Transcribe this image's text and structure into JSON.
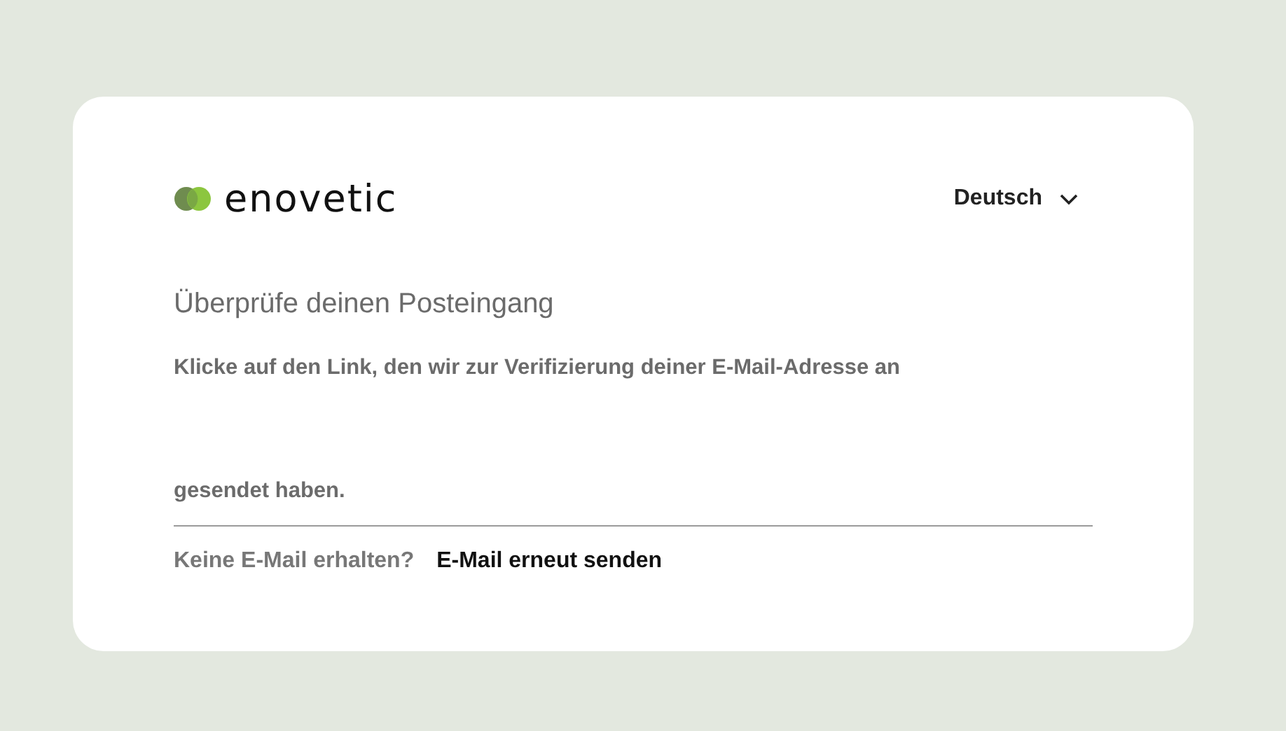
{
  "brand": {
    "name": "enovetic"
  },
  "language": {
    "label": "Deutsch"
  },
  "heading": "Überprüfe deinen Posteingang",
  "message": "Klicke auf den Link, den wir zur Verifizierung deiner E-Mail-Adresse an gesendet haben.",
  "footer": {
    "question": "Keine E-Mail erhalten?",
    "link": "E-Mail erneut senden"
  }
}
